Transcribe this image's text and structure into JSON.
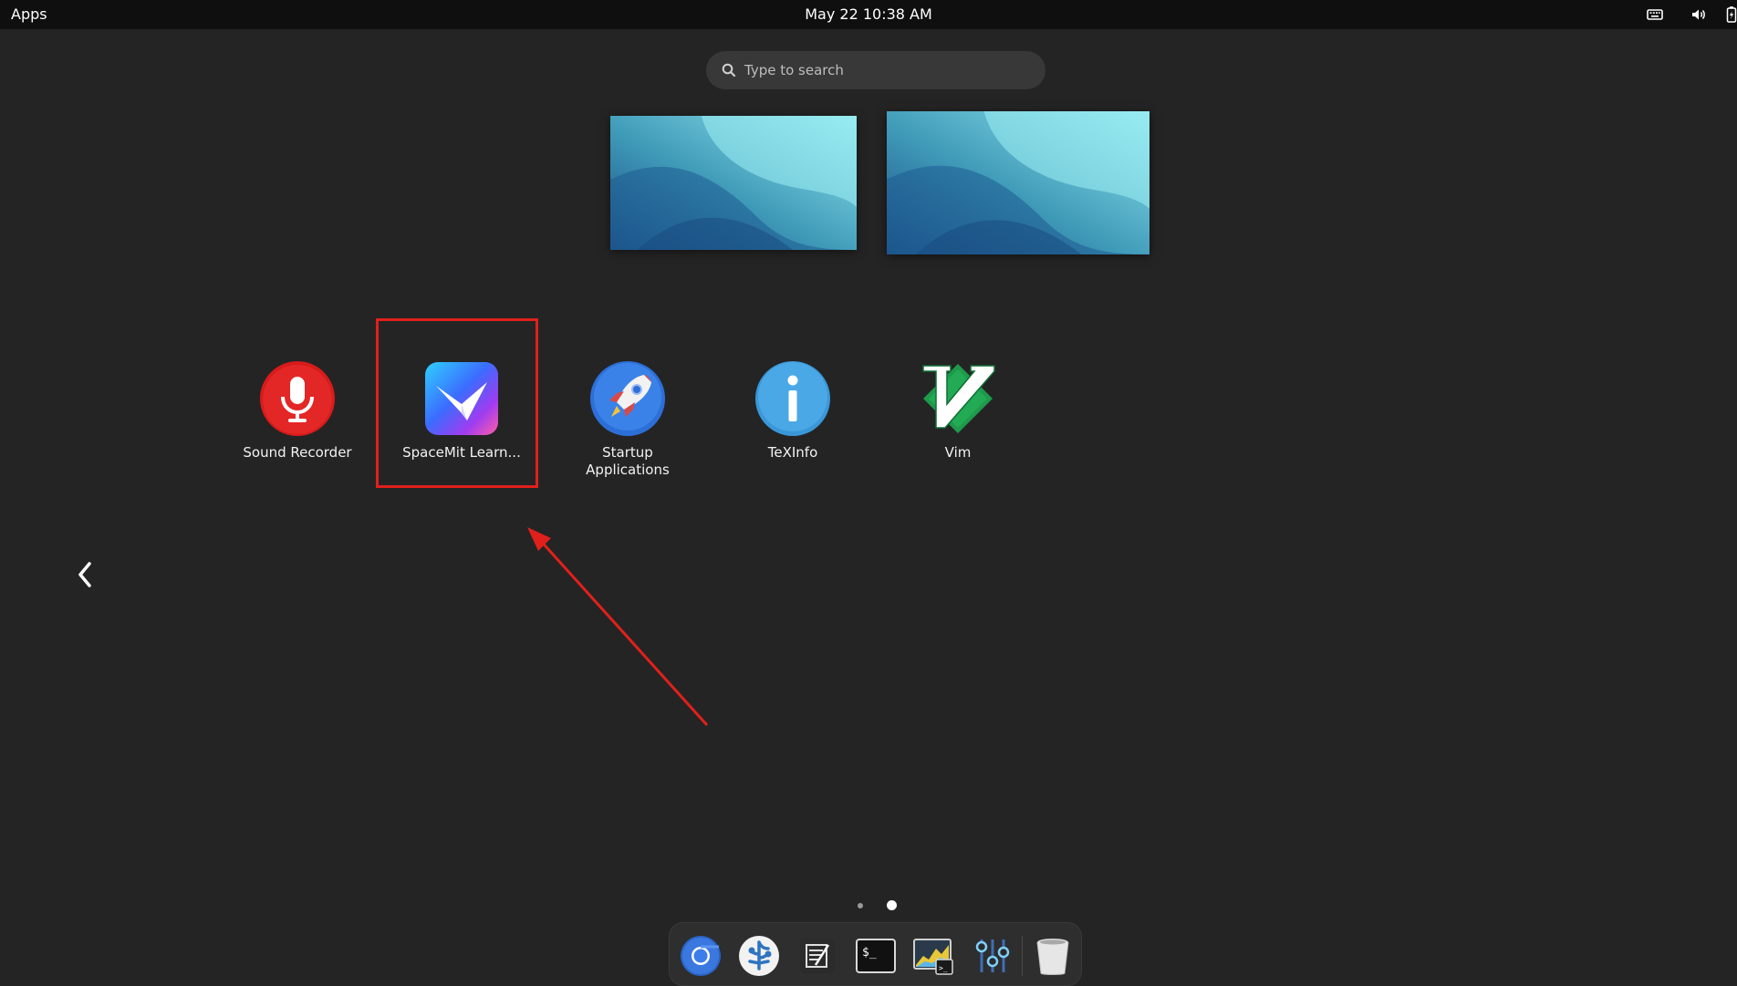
{
  "topbar": {
    "activities_label": "Apps",
    "clock": "May 22  10:38 AM",
    "tray_icons": [
      "keyboard-icon",
      "volume-icon",
      "battery-icon"
    ]
  },
  "search": {
    "placeholder": "Type to search",
    "value": ""
  },
  "workspaces": [
    {
      "name": "workspace-1-thumbnail"
    },
    {
      "name": "workspace-2-thumbnail"
    }
  ],
  "apps": [
    {
      "label": "Sound Recorder",
      "icon": "microphone-icon"
    },
    {
      "label": "SpaceMit Learn...",
      "icon": "spacemit-learn-icon"
    },
    {
      "label": "Startup Applications",
      "icon": "rocket-icon"
    },
    {
      "label": "TeXInfo",
      "icon": "info-icon"
    },
    {
      "label": "Vim",
      "icon": "vim-icon"
    }
  ],
  "pager": {
    "pages": 2,
    "current_page": 2
  },
  "dash": {
    "items": [
      {
        "name": "chromium",
        "icon": "chromium-icon"
      },
      {
        "name": "vscode",
        "icon": "vscode-icon"
      },
      {
        "name": "text-editor",
        "icon": "text-editor-icon"
      },
      {
        "name": "terminal",
        "icon": "terminal-icon"
      },
      {
        "name": "system-monitor",
        "icon": "system-monitor-icon"
      },
      {
        "name": "settings-tweaks",
        "icon": "tweaks-icon"
      },
      {
        "name": "trash",
        "icon": "trash-icon"
      }
    ]
  },
  "colors": {
    "background": "#242424",
    "topbar": "#0f0f0f",
    "highlight_annotation": "#e0201b"
  }
}
